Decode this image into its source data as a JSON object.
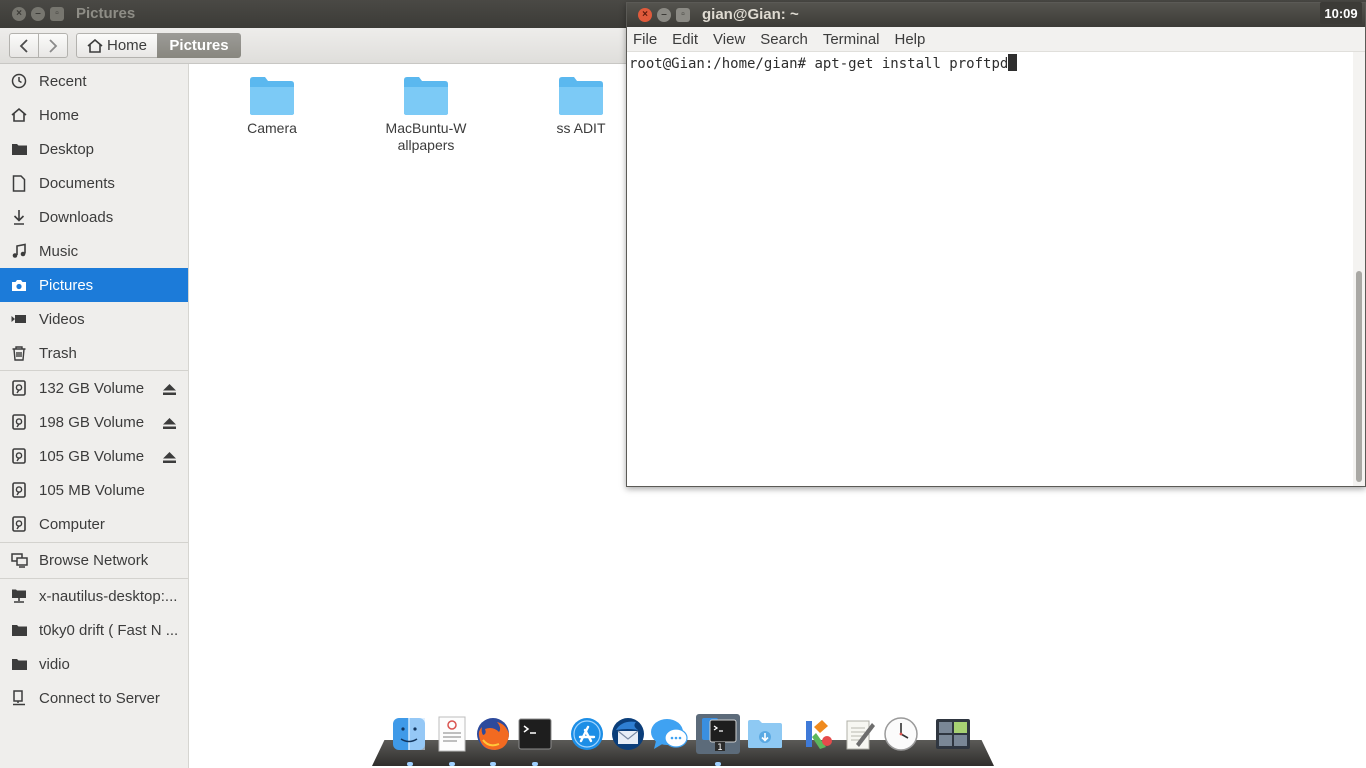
{
  "nautilus": {
    "title": "Pictures",
    "breadcrumb": {
      "home_label": "Home",
      "current_label": "Pictures"
    },
    "sidebar": {
      "places": [
        {
          "label": "Recent",
          "icon": "clock-icon"
        },
        {
          "label": "Home",
          "icon": "home-icon"
        },
        {
          "label": "Desktop",
          "icon": "folder-icon"
        },
        {
          "label": "Documents",
          "icon": "document-icon"
        },
        {
          "label": "Downloads",
          "icon": "download-icon"
        },
        {
          "label": "Music",
          "icon": "music-icon"
        },
        {
          "label": "Pictures",
          "icon": "camera-icon",
          "active": true
        },
        {
          "label": "Videos",
          "icon": "video-icon"
        },
        {
          "label": "Trash",
          "icon": "trash-icon"
        }
      ],
      "devices": [
        {
          "label": "132 GB Volume",
          "icon": "drive-icon",
          "eject": true
        },
        {
          "label": "198 GB Volume",
          "icon": "drive-icon",
          "eject": true
        },
        {
          "label": "105 GB Volume",
          "icon": "drive-icon",
          "eject": true
        },
        {
          "label": "105 MB Volume",
          "icon": "drive-icon",
          "eject": false
        },
        {
          "label": "Computer",
          "icon": "drive-icon",
          "eject": false
        }
      ],
      "network": [
        {
          "label": "Browse Network",
          "icon": "network-icon"
        }
      ],
      "bookmarks": [
        {
          "label": "x-nautilus-desktop:...",
          "icon": "network-folder-icon"
        },
        {
          "label": "t0ky0 drift ( Fast N ...",
          "icon": "folder-icon"
        },
        {
          "label": "vidio",
          "icon": "folder-icon"
        },
        {
          "label": "Connect to Server",
          "icon": "server-icon"
        }
      ]
    },
    "files": [
      {
        "name": "Camera"
      },
      {
        "name": "MacBuntu-Wallpapers"
      },
      {
        "name": "ss ADIT"
      }
    ]
  },
  "terminal": {
    "title": "gian@Gian: ~",
    "menus": [
      "File",
      "Edit",
      "View",
      "Search",
      "Terminal",
      "Help"
    ],
    "prompt": "root@Gian:/home/gian# ",
    "command": "apt-get install proftpd"
  },
  "panel": {
    "clock": "10:09"
  },
  "dock": {
    "apps": [
      "finder-icon",
      "text-editor-icon",
      "firefox-icon",
      "terminal-icon",
      "app-store-icon",
      "thunderbird-icon",
      "messages-icon",
      "terminal-active-icon",
      "downloads-folder-icon",
      "settings-tools-icon",
      "notepad-icon",
      "clock-app-icon",
      "workspace-switcher-icon"
    ]
  },
  "colors": {
    "selection": "#1c7bd9",
    "folder": "#5bb8ef",
    "titlebar": "#3c3b37"
  }
}
